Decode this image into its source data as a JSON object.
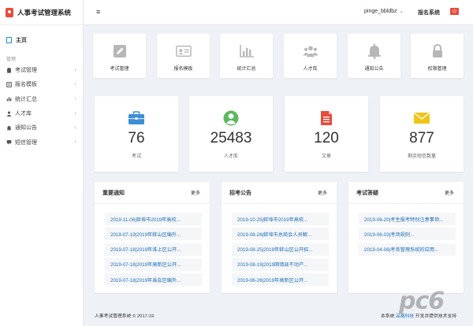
{
  "app": {
    "title": "人事考试管理系统"
  },
  "sidebar": {
    "home_label": "主页",
    "section_label": "管理",
    "items": [
      {
        "label": "考试管理",
        "icon": "clipboard-icon"
      },
      {
        "label": "报名模板",
        "icon": "form-icon"
      },
      {
        "label": "统计汇总",
        "icon": "chart-icon"
      },
      {
        "label": "人才库",
        "icon": "users-icon"
      },
      {
        "label": "通知公告",
        "icon": "bell-icon"
      },
      {
        "label": "短信管理",
        "icon": "message-icon"
      }
    ]
  },
  "header": {
    "menu_toggle": "≡",
    "username": "pinge_bbldbz",
    "system_link": "报名系统"
  },
  "quick_links": [
    {
      "label": "考试管理",
      "icon": "pencil-icon"
    },
    {
      "label": "报名模板",
      "icon": "id-card-icon"
    },
    {
      "label": "统计汇总",
      "icon": "bar-chart-icon"
    },
    {
      "label": "人才库",
      "icon": "users-icon"
    },
    {
      "label": "通知公告",
      "icon": "bell-icon"
    },
    {
      "label": "权限管理",
      "icon": "lock-icon"
    }
  ],
  "stats": [
    {
      "value": "76",
      "label": "考试",
      "icon": "briefcase-icon",
      "color": "#3d8fd1"
    },
    {
      "value": "25483",
      "label": "人才库",
      "icon": "user-circle-icon",
      "color": "#5cb85c"
    },
    {
      "value": "120",
      "label": "文章",
      "icon": "document-icon",
      "color": "#e74c3c"
    },
    {
      "value": "877",
      "label": "剩余短信数量",
      "icon": "envelope-icon",
      "color": "#f0c419"
    }
  ],
  "panels": [
    {
      "title": "重要通知",
      "more": "更多",
      "items": [
        "2019-11-06|蚌埠市2019年高校...",
        "2019-07-19|2019年蚌山区编外...",
        "2019-07-18|2019年淮上区公开...",
        "2019-07-18|2019年高新区公开...",
        "2019-07-18|2019年禹会区编外..."
      ]
    },
    {
      "title": "招考公告",
      "more": "更多",
      "items": [
        "2019-10-25|蚌埠市2019年高校...",
        "2019-08-26|蚌埠市总商会人员解...",
        "2019-08-25|2019年蚌山区公开招...",
        "2019-08-19|2019固镇县不动产...",
        "2019-06-26|2019年高新区公开..."
      ]
    },
    {
      "title": "考试答疑",
      "more": "更多",
      "items": [
        "2019-06-20|考生报考特别注意事项...",
        "2019-06-03|考场规则...",
        "2019-04-06|考务管理系统的应用..."
      ]
    }
  ],
  "footer": {
    "copyright": "人事考试管理系统 © 2017-19",
    "support_prefix": "本系统",
    "support_link": "品格科技",
    "support_suffix": "开发并提供技术支持"
  },
  "watermark": "pc6"
}
